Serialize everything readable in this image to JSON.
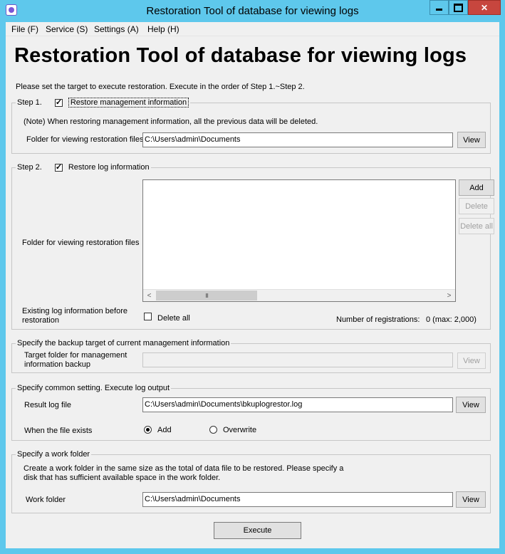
{
  "window": {
    "title": "Restoration Tool of database for viewing logs",
    "controls": {
      "minimize": "",
      "maximize": "",
      "close": "✕"
    }
  },
  "menu": [
    {
      "label": "File (F)"
    },
    {
      "label": "Service (S)"
    },
    {
      "label": "Settings (A)"
    },
    {
      "label": "Help (H)"
    }
  ],
  "heading": "Restoration Tool of database for viewing logs",
  "instruction": "Please set the target to execute restoration. Execute in the order of Step 1.~Step 2.",
  "step1": {
    "legend": "Step 1.",
    "checkbox_label": "Restore management information",
    "checked": true,
    "note": "(Note) When restoring management information, all the previous data will be deleted.",
    "folder_label": "Folder for viewing restoration files",
    "folder_value": "C:\\Users\\admin\\Documents",
    "view_button": "View"
  },
  "step2": {
    "legend": "Step 2.",
    "checkbox_label": "Restore log information",
    "checked": true,
    "folder_label": "Folder for viewing restoration files",
    "add_button": "Add",
    "delete_button": "Delete",
    "delete_all_button": "Delete all",
    "existing_label": "Existing log information before restoration",
    "delete_all_checkbox_label": "Delete all",
    "delete_all_checked": false,
    "registrations_label": "Number of registrations:",
    "registrations_value": "0 (max: 2,000)",
    "scroll_left": "<",
    "scroll_right": ">",
    "scroll_thumb": "III"
  },
  "backup": {
    "legend": "Specify the backup target of current management information",
    "folder_label": "Target folder for management information backup",
    "folder_value": "",
    "view_button": "View"
  },
  "common": {
    "legend": "Specify common setting.  Execute log output",
    "result_label": "Result log file",
    "result_value": "C:\\Users\\admin\\Documents\\bkuplogrestor.log",
    "view_button": "View",
    "exists_label": "When the file exists",
    "option_add": "Add",
    "option_overwrite": "Overwrite",
    "selected": "Add"
  },
  "work": {
    "legend": "Specify a work folder",
    "description": "Create a work folder in the same size as the total of data file to be restored. Please specify a disk that has sufficient available space in the work folder.",
    "folder_label": "Work folder",
    "folder_value": "C:\\Users\\admin\\Documents",
    "view_button": "View"
  },
  "execute_button": "Execute"
}
